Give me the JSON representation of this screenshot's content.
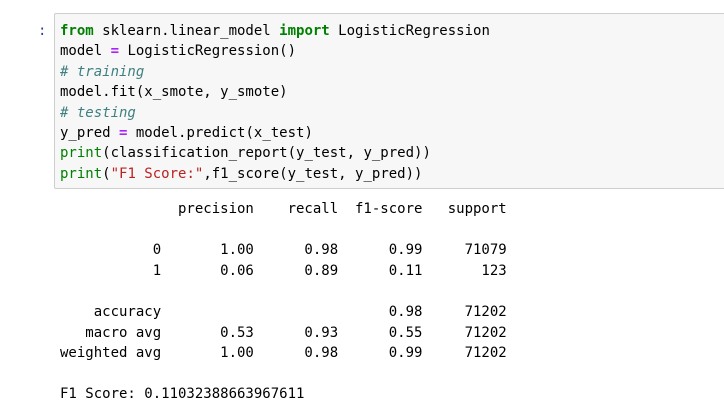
{
  "cell": {
    "prompt": ":",
    "lines": [
      [
        {
          "t": "from",
          "c": "kw"
        },
        {
          "t": " sklearn.linear_model ",
          "c": ""
        },
        {
          "t": "import",
          "c": "kw"
        },
        {
          "t": " LogisticRegression",
          "c": ""
        }
      ],
      [
        {
          "t": "model ",
          "c": ""
        },
        {
          "t": "=",
          "c": "op"
        },
        {
          "t": " LogisticRegression()",
          "c": ""
        }
      ],
      [
        {
          "t": "# training",
          "c": "cm"
        }
      ],
      [
        {
          "t": "model.fit(x_smote, y_smote)",
          "c": ""
        }
      ],
      [
        {
          "t": "# testing",
          "c": "cm"
        }
      ],
      [
        {
          "t": "y_pred ",
          "c": ""
        },
        {
          "t": "=",
          "c": "op"
        },
        {
          "t": " model.predict(x_test)",
          "c": ""
        }
      ],
      [
        {
          "t": "print",
          "c": "bi"
        },
        {
          "t": "(classification_report(y_test, y_pred))",
          "c": ""
        }
      ],
      [
        {
          "t": "print",
          "c": "bi"
        },
        {
          "t": "(",
          "c": ""
        },
        {
          "t": "\"F1 Score:\"",
          "c": "st"
        },
        {
          "t": ",f1_score(y_test, y_pred))",
          "c": ""
        }
      ]
    ]
  },
  "output": {
    "lines": [
      "              precision    recall  f1-score   support",
      "",
      "           0       1.00      0.98      0.99     71079",
      "           1       0.06      0.89      0.11       123",
      "",
      "    accuracy                           0.98     71202",
      "   macro avg       0.53      0.93      0.55     71202",
      "weighted avg       1.00      0.98      0.99     71202",
      "",
      "F1 Score: 0.11032388663967611"
    ]
  },
  "colors": {
    "keyword": "#008000",
    "operator": "#aa22ff",
    "comment": "#408080",
    "string": "#ba2121",
    "cell_bg": "#f7f7f7",
    "cell_border": "#cfcfcf"
  }
}
